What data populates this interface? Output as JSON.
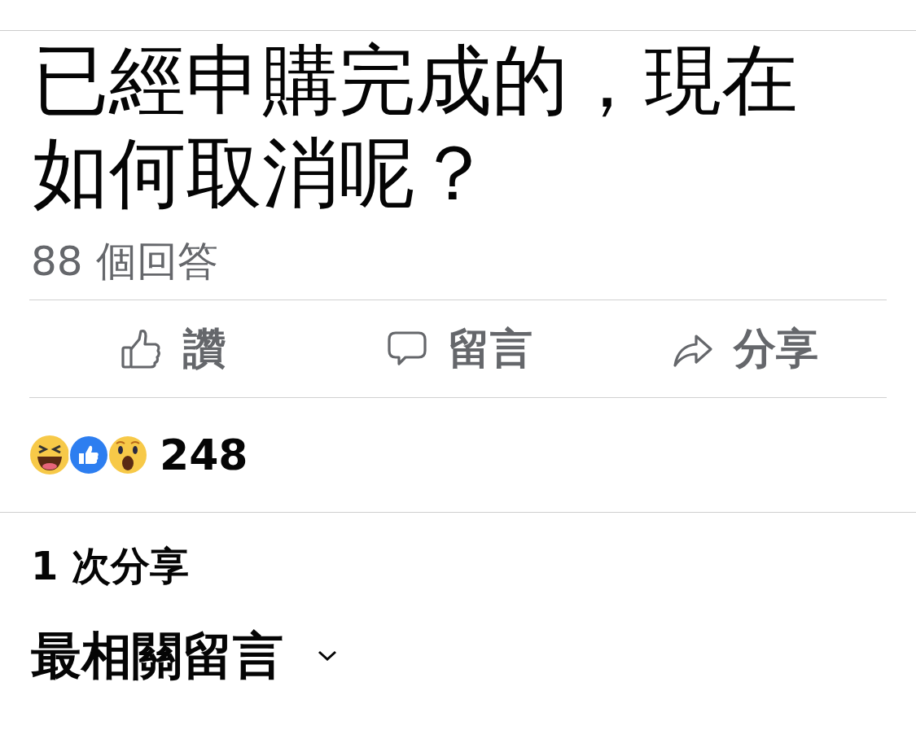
{
  "post": {
    "title": "已經申購完成的，現在如何取消呢？",
    "answer_count": "88 個回答"
  },
  "actions": [
    {
      "kind": "like",
      "label": "讚"
    },
    {
      "kind": "comment",
      "label": "留言"
    },
    {
      "kind": "share",
      "label": "分享"
    }
  ],
  "reactions": {
    "count": "248"
  },
  "shares": "1 次分享",
  "comments_sort": {
    "label": "最相關留言"
  }
}
